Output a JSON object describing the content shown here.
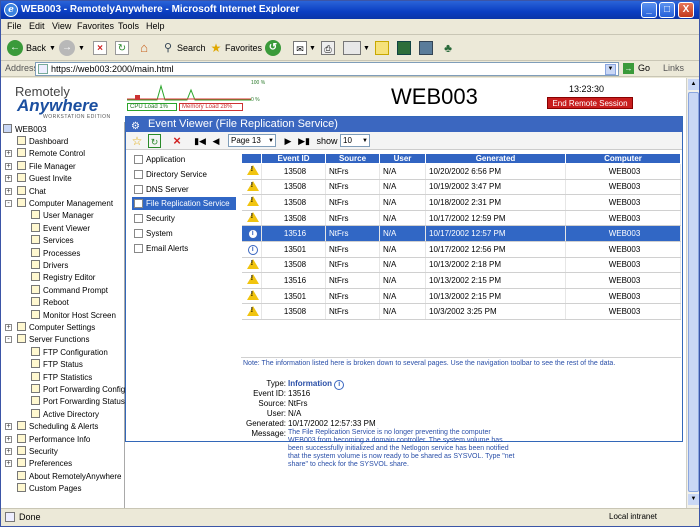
{
  "window": {
    "title": "WEB003 - RemotelyAnywhere - Microsoft Internet Explorer",
    "controls": [
      "_",
      "□",
      "X"
    ]
  },
  "menu": [
    "File",
    "Edit",
    "View",
    "Favorites",
    "Tools",
    "Help"
  ],
  "toolbar": {
    "back": "Back",
    "search": "Search",
    "favorites": "Favorites"
  },
  "address": {
    "label": "Address",
    "url": "https://web003:2000/main.html",
    "go": "Go",
    "links": "Links"
  },
  "header": {
    "logo_line1": "Remotely",
    "logo_line2": "Anywhere",
    "logo_line3": "WORKSTATION EDITION",
    "cpu_label": "CPU Load 1%",
    "mem_label": "Memory Load 28%",
    "gauge_top": "100 %",
    "gauge_bottom": "0 %",
    "cpu_load_pct": 1,
    "memory_load_pct": 28,
    "hostname": "WEB003",
    "clock": "13:23:30",
    "end_session": "End Remote Session"
  },
  "tree": {
    "root": "WEB003",
    "items": [
      {
        "label": "Dashboard",
        "level": 1,
        "expander": ""
      },
      {
        "label": "Remote Control",
        "level": 1,
        "expander": "+"
      },
      {
        "label": "File Manager",
        "level": 1,
        "expander": "+"
      },
      {
        "label": "Guest Invite",
        "level": 1,
        "expander": "+"
      },
      {
        "label": "Chat",
        "level": 1,
        "expander": "+"
      },
      {
        "label": "Computer Management",
        "level": 1,
        "expander": "-"
      },
      {
        "label": "User Manager",
        "level": 2,
        "expander": ""
      },
      {
        "label": "Event Viewer",
        "level": 2,
        "expander": ""
      },
      {
        "label": "Services",
        "level": 2,
        "expander": ""
      },
      {
        "label": "Processes",
        "level": 2,
        "expander": ""
      },
      {
        "label": "Drivers",
        "level": 2,
        "expander": ""
      },
      {
        "label": "Registry Editor",
        "level": 2,
        "expander": ""
      },
      {
        "label": "Command Prompt",
        "level": 2,
        "expander": ""
      },
      {
        "label": "Reboot",
        "level": 2,
        "expander": ""
      },
      {
        "label": "Monitor Host Screen",
        "level": 2,
        "expander": ""
      },
      {
        "label": "Computer Settings",
        "level": 1,
        "expander": "+"
      },
      {
        "label": "Server Functions",
        "level": 1,
        "expander": "-"
      },
      {
        "label": "FTP Configuration",
        "level": 2,
        "expander": ""
      },
      {
        "label": "FTP Status",
        "level": 2,
        "expander": ""
      },
      {
        "label": "FTP Statistics",
        "level": 2,
        "expander": ""
      },
      {
        "label": "Port Forwarding Config",
        "level": 2,
        "expander": ""
      },
      {
        "label": "Port Forwarding Status",
        "level": 2,
        "expander": ""
      },
      {
        "label": "Active Directory",
        "level": 2,
        "expander": ""
      },
      {
        "label": "Scheduling & Alerts",
        "level": 1,
        "expander": "+"
      },
      {
        "label": "Performance Info",
        "level": 1,
        "expander": "+"
      },
      {
        "label": "Security",
        "level": 1,
        "expander": "+"
      },
      {
        "label": "Preferences",
        "level": 1,
        "expander": "+"
      },
      {
        "label": "About RemotelyAnywhere",
        "level": 1,
        "expander": ""
      },
      {
        "label": "Custom Pages",
        "level": 1,
        "expander": ""
      }
    ]
  },
  "panel": {
    "title": "Event Viewer (File Replication Service)",
    "page_select": "Page 13",
    "show_label": "show",
    "show_select": "10",
    "logs": [
      "Application",
      "Directory Service",
      "DNS Server",
      "File Replication Service",
      "Security",
      "System",
      "Email Alerts"
    ],
    "active_log": 3,
    "columns": [
      "Event ID",
      "Source",
      "User",
      "Generated",
      "Computer"
    ],
    "rows": [
      {
        "type": "warning",
        "id": "13508",
        "source": "NtFrs",
        "user": "N/A",
        "generated": "10/20/2002 6:56 PM",
        "computer": "WEB003"
      },
      {
        "type": "warning",
        "id": "13508",
        "source": "NtFrs",
        "user": "N/A",
        "generated": "10/19/2002 3:47 PM",
        "computer": "WEB003"
      },
      {
        "type": "warning",
        "id": "13508",
        "source": "NtFrs",
        "user": "N/A",
        "generated": "10/18/2002 2:31 PM",
        "computer": "WEB003"
      },
      {
        "type": "warning",
        "id": "13508",
        "source": "NtFrs",
        "user": "N/A",
        "generated": "10/17/2002 12:59 PM",
        "computer": "WEB003"
      },
      {
        "type": "info",
        "id": "13516",
        "source": "NtFrs",
        "user": "N/A",
        "generated": "10/17/2002 12:57 PM",
        "computer": "WEB003",
        "selected": true
      },
      {
        "type": "info",
        "id": "13501",
        "source": "NtFrs",
        "user": "N/A",
        "generated": "10/17/2002 12:56 PM",
        "computer": "WEB003"
      },
      {
        "type": "warning",
        "id": "13508",
        "source": "NtFrs",
        "user": "N/A",
        "generated": "10/13/2002 2:18 PM",
        "computer": "WEB003"
      },
      {
        "type": "warning",
        "id": "13516",
        "source": "NtFrs",
        "user": "N/A",
        "generated": "10/13/2002 2:15 PM",
        "computer": "WEB003"
      },
      {
        "type": "warning",
        "id": "13501",
        "source": "NtFrs",
        "user": "N/A",
        "generated": "10/13/2002 2:15 PM",
        "computer": "WEB003"
      },
      {
        "type": "warning",
        "id": "13508",
        "source": "NtFrs",
        "user": "N/A",
        "generated": "10/3/2002 3:25 PM",
        "computer": "WEB003"
      }
    ],
    "note": "Note: The information listed here is broken down to several pages. Use the navigation toolbar to see the rest of the data."
  },
  "detail": {
    "labels": {
      "type": "Type:",
      "event_id": "Event ID:",
      "source": "Source:",
      "user": "User:",
      "generated": "Generated:",
      "message": "Message:"
    },
    "type": "Information",
    "event_id": "13516",
    "source": "NtFrs",
    "user": "N/A",
    "generated": "10/17/2002 12:57:33 PM",
    "message": "The File Replication Service is no longer preventing the computer WEB003 from becoming a domain controller. The system volume has been successfully initialized and the Netlogon service has been notified that the system volume is now ready to be shared as SYSVOL. Type \"net share\" to check for the SYSVOL share."
  },
  "status": {
    "text": "Done",
    "zone": "Local intranet"
  }
}
